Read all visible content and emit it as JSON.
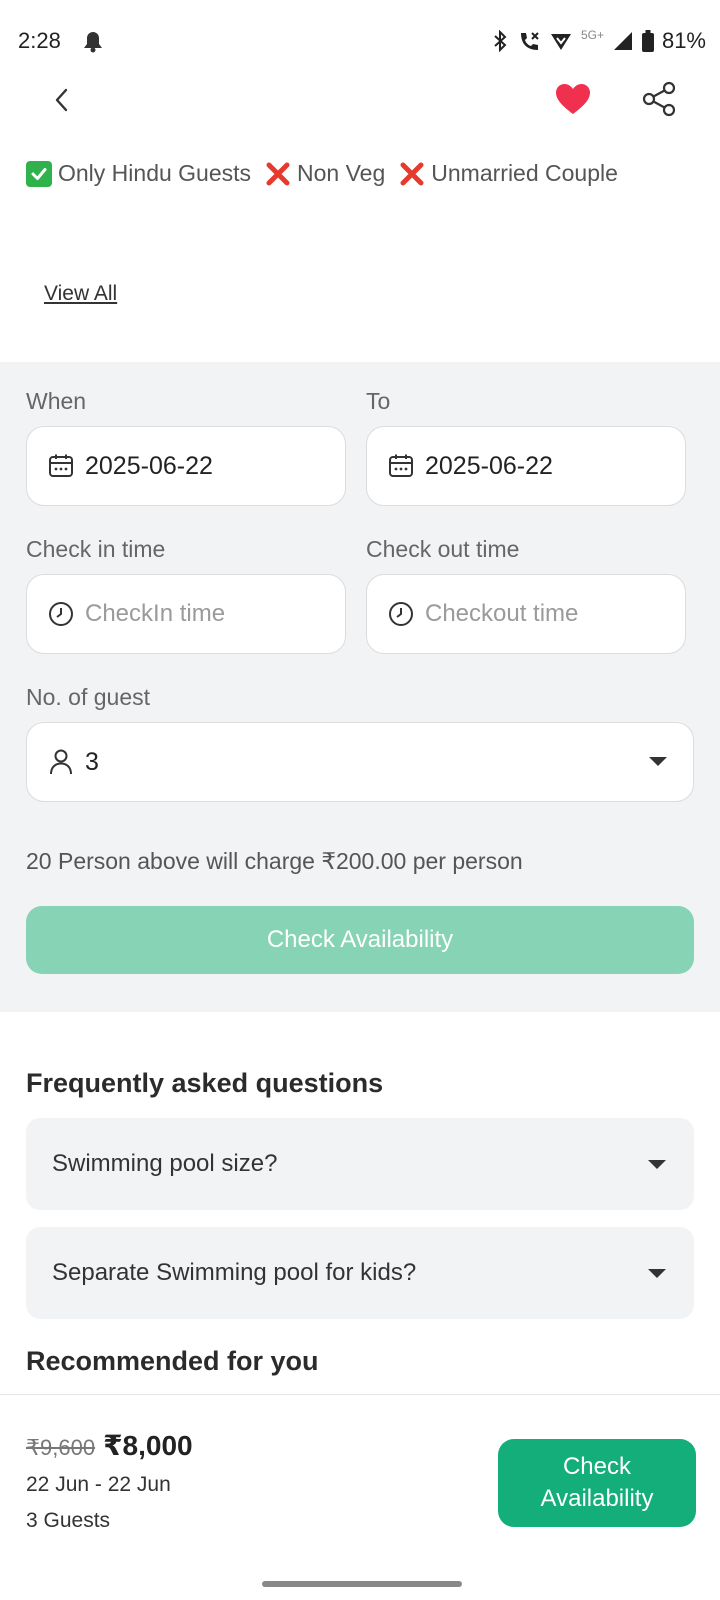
{
  "status_bar": {
    "time": "2:28",
    "network_label": "5G+",
    "battery": "81%",
    "icons": [
      "bell-off-icon",
      "bluetooth-icon",
      "wifi-call-icon",
      "vpn-shield-icon",
      "signal-icon",
      "battery-icon"
    ]
  },
  "nav": {
    "back_icon": "chevron-left-icon",
    "favorite_icon": "heart-icon",
    "favorite_color": "#f0304f",
    "share_icon": "share-icon"
  },
  "rules": [
    {
      "icon": "check-box-icon",
      "label": "Only Hindu Guests"
    },
    {
      "icon": "cross-icon",
      "label": "Non Veg"
    },
    {
      "icon": "cross-icon",
      "label": "Unmarried Couple"
    }
  ],
  "view_all": "View All",
  "booking": {
    "when_label": "When",
    "when_value": "2025-06-22",
    "to_label": "To",
    "to_value": "2025-06-22",
    "checkin_label": "Check in time",
    "checkin_placeholder": "CheckIn time",
    "checkout_label": "Check out time",
    "checkout_placeholder": "Checkout time",
    "guest_label": "No. of guest",
    "guest_value": "3",
    "charge_note": "20 Person above will charge ₹200.00 per person",
    "check_button": "Check Availability",
    "check_button_color": "#86d3b6"
  },
  "faq": {
    "title": "Frequently asked questions",
    "items": [
      "Swimming pool size?",
      "Separate Swimming pool for kids?"
    ]
  },
  "recommended_title": "Recommended for you",
  "bottom_bar": {
    "old_price": "₹9,600",
    "new_price": "₹8,000",
    "date_range": "22 Jun - 22 Jun",
    "guests": "3 Guests",
    "button_line1": "Check",
    "button_line2": "Availability",
    "button_color": "#14ae7a"
  }
}
